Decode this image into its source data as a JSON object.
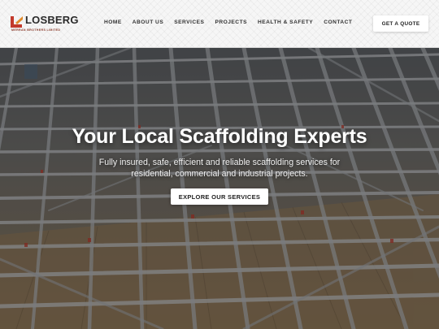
{
  "brand": {
    "name": "LOSBERG",
    "tagline": "MERRAN BROTHERS LIMITED"
  },
  "nav": {
    "items": [
      {
        "label": "HOME"
      },
      {
        "label": "ABOUT US"
      },
      {
        "label": "SERVICES"
      },
      {
        "label": "PROJECTS"
      },
      {
        "label": "HEALTH & SAFETY"
      },
      {
        "label": "CONTACT"
      }
    ],
    "quote_label": "GET A QUOTE"
  },
  "hero": {
    "title": "Your Local Scaffolding Experts",
    "subtitle": "Fully insured, safe, efficient and reliable scaffolding services for residential, commercial and industrial projects.",
    "cta_label": "EXPLORE OUR SERVICES"
  },
  "colors": {
    "brand_red": "#c23a2b",
    "brand_orange": "#e08a2a",
    "text_dark": "#222222"
  },
  "icons": {
    "logo": "losberg-logo-icon"
  }
}
